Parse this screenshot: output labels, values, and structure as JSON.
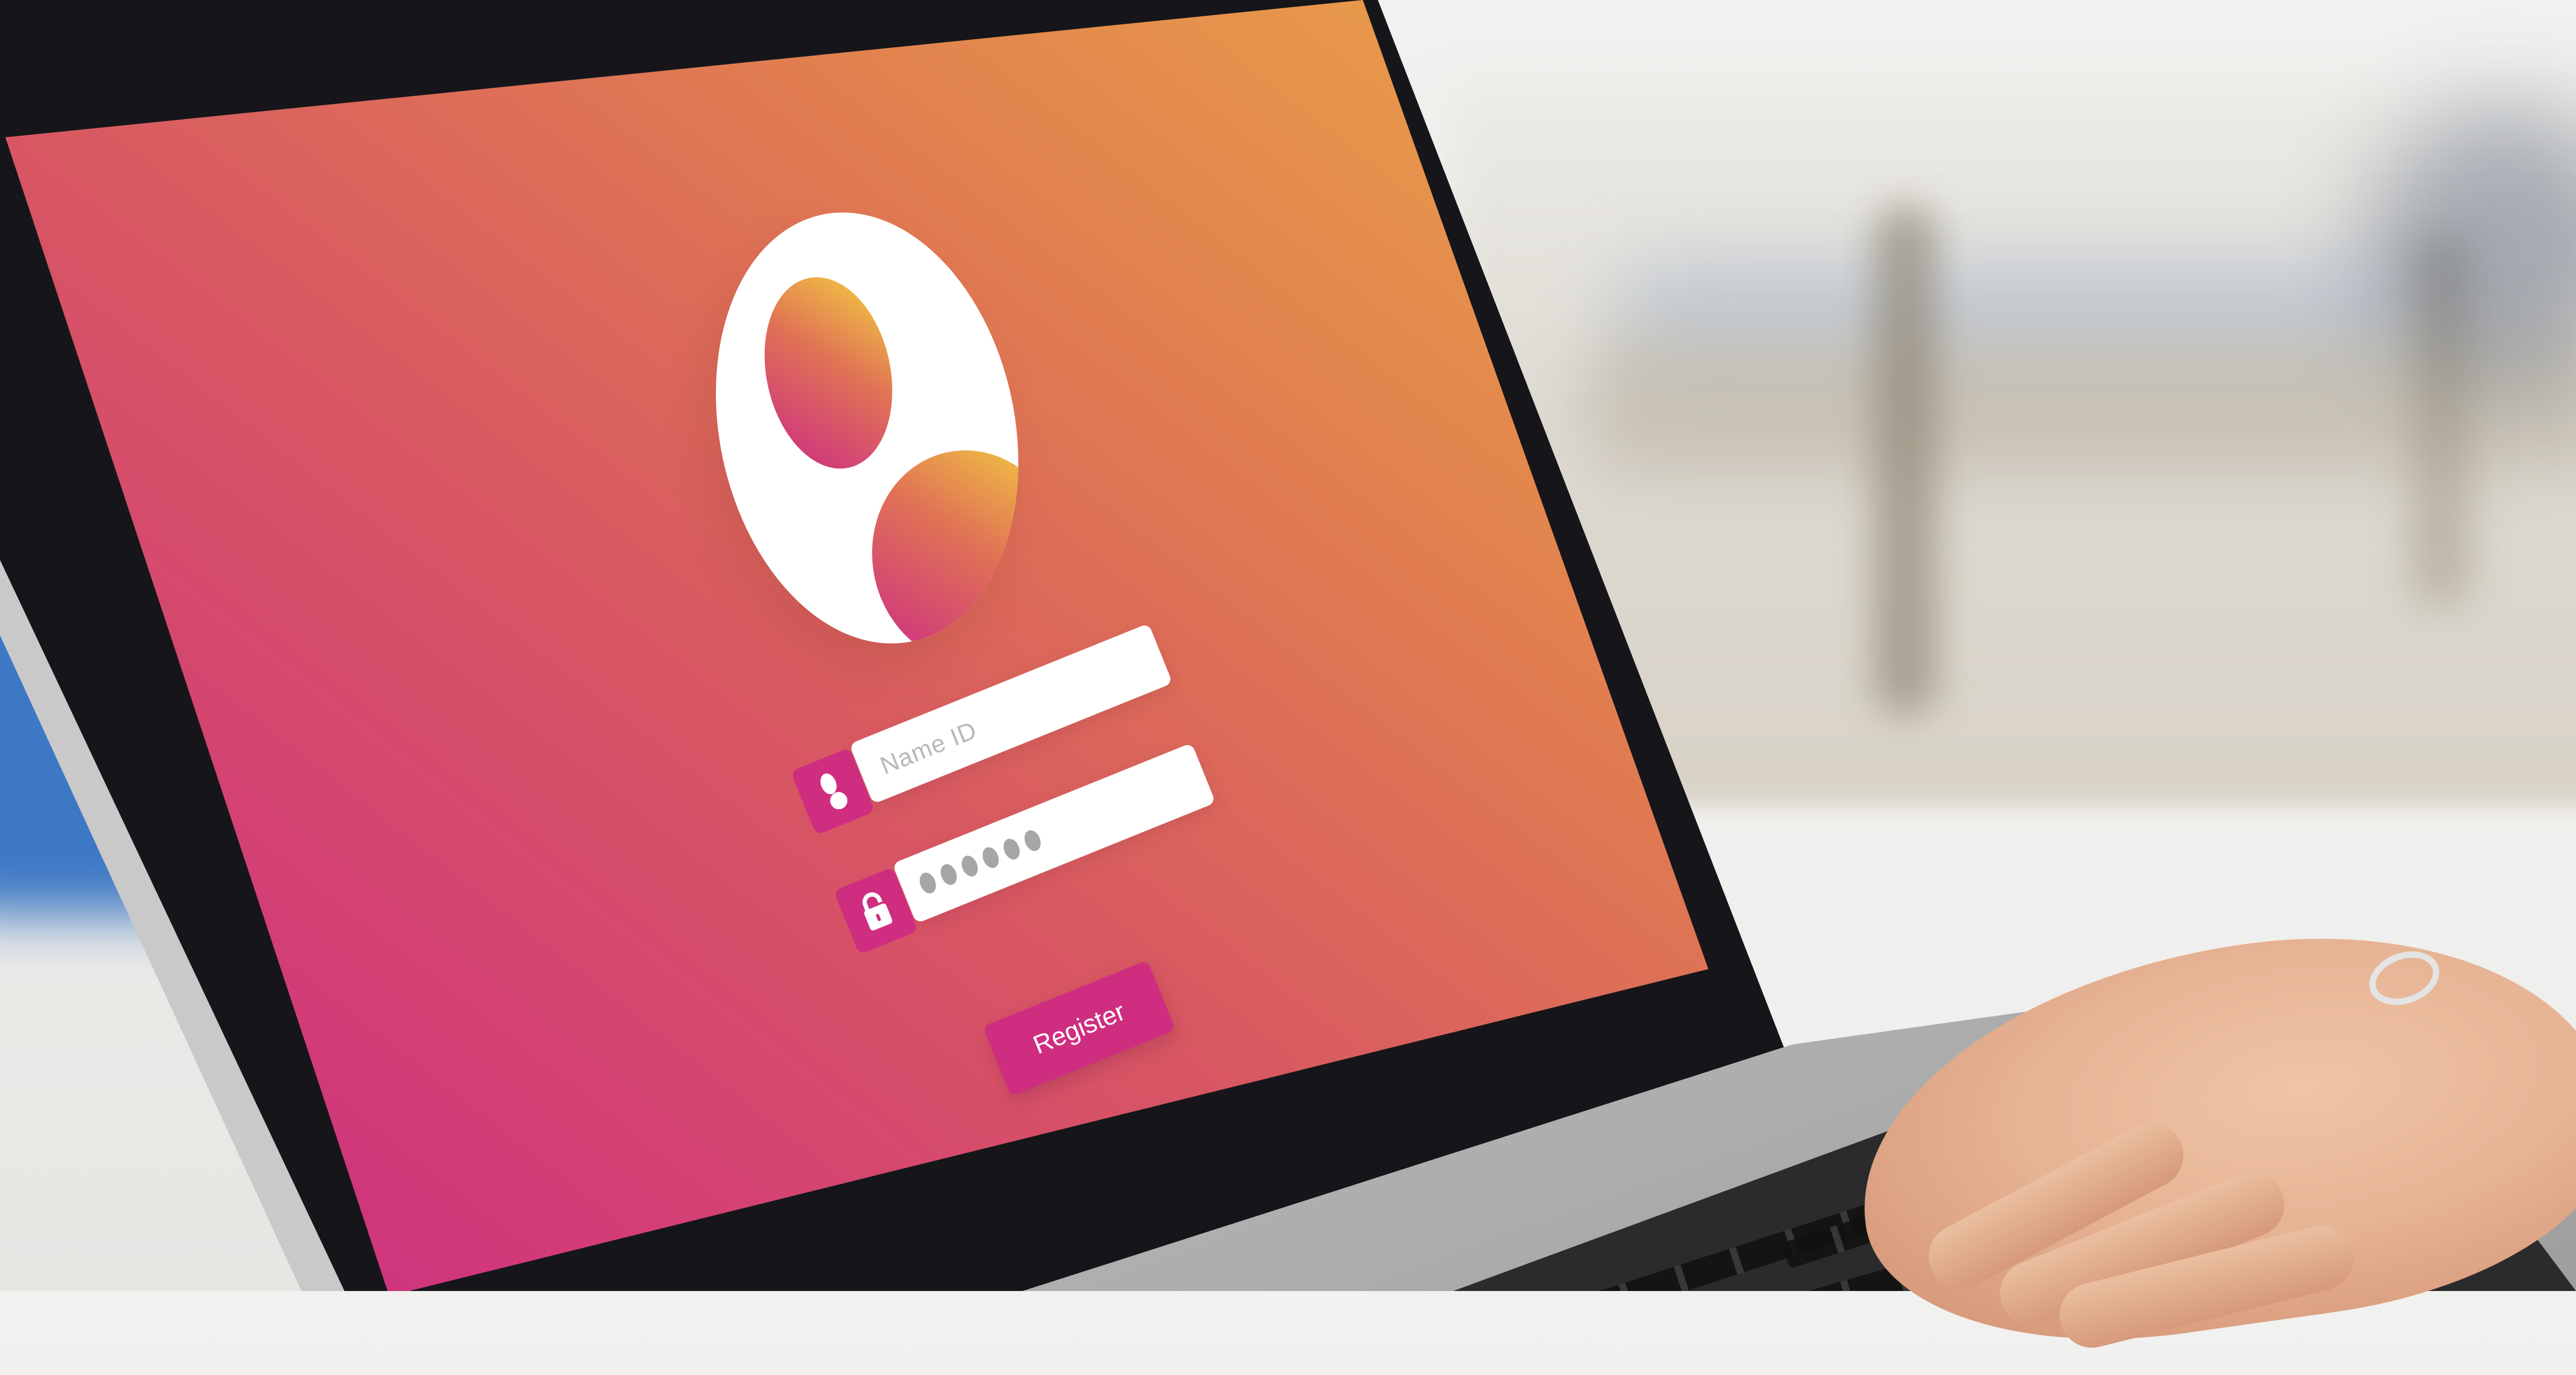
{
  "login_screen": {
    "name_field": {
      "placeholder": "Name ID",
      "icon": "user-icon"
    },
    "password_field": {
      "masked_value": "●●●●●●",
      "icon": "lock-icon"
    },
    "register_button": {
      "label": "Register"
    },
    "avatar": {
      "icon": "user-avatar-icon"
    }
  },
  "colors": {
    "accent": "#cf2e80",
    "gradient_top": "#f2e042",
    "gradient_bottom": "#c92b82",
    "field_bg": "#ffffff"
  }
}
